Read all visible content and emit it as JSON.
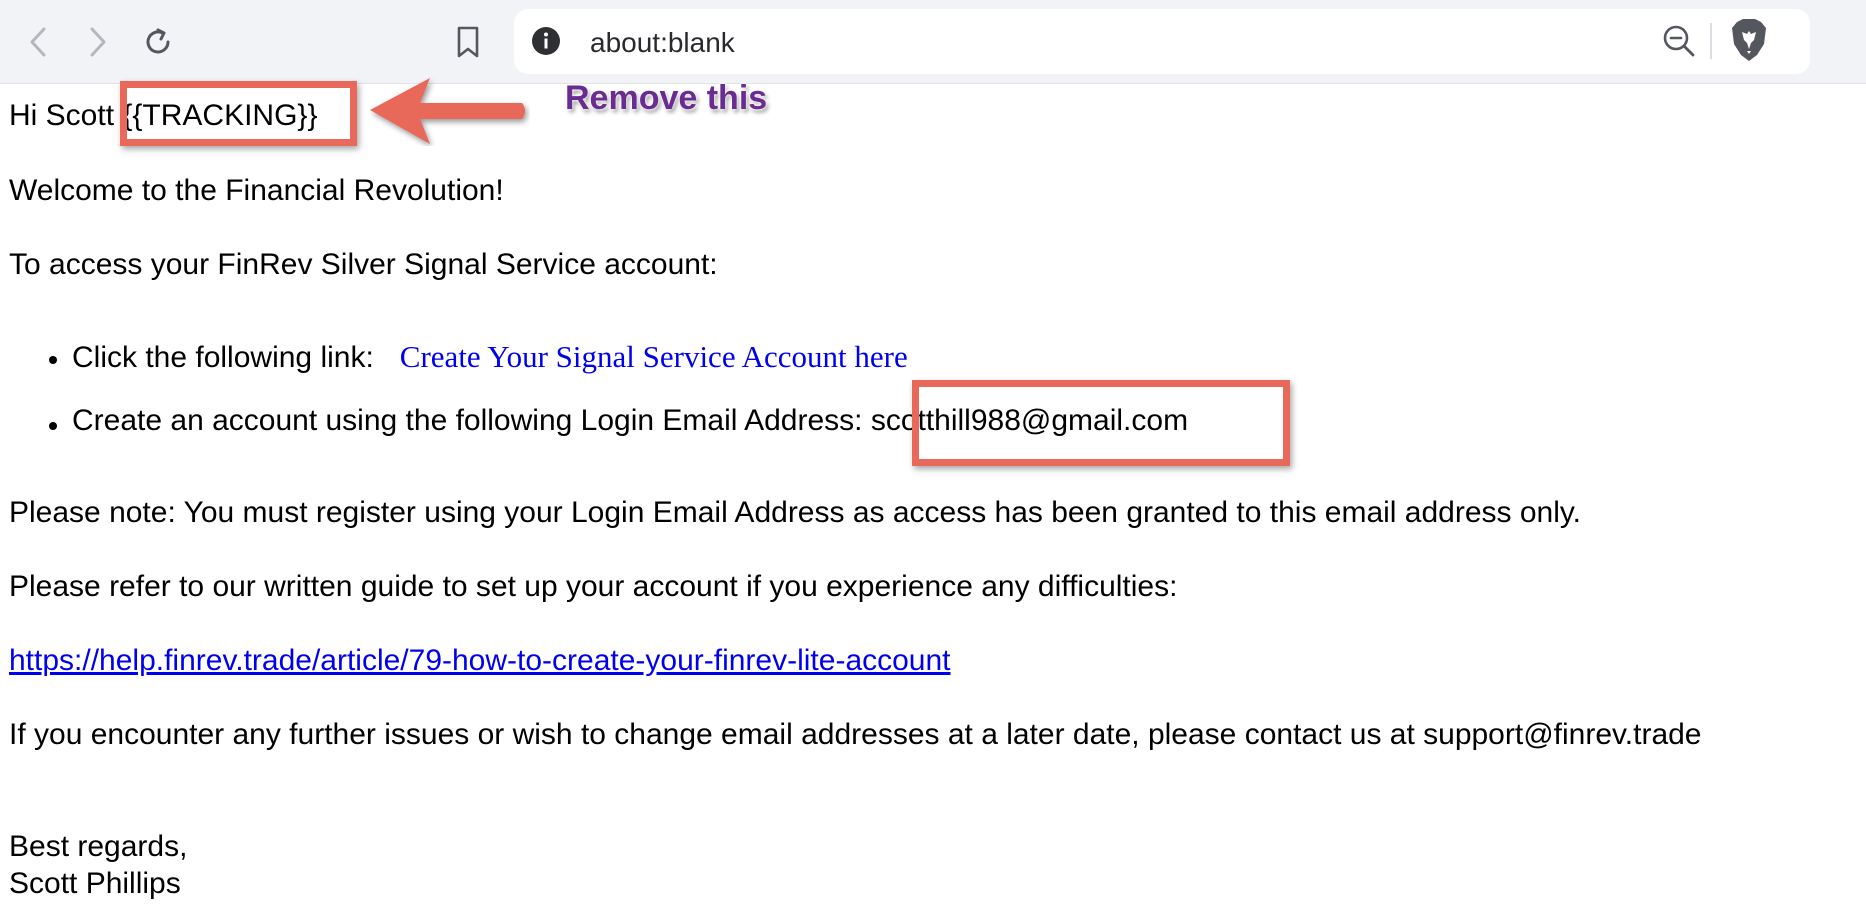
{
  "browser": {
    "back_icon": "chevron-left-icon",
    "forward_icon": "chevron-right-icon",
    "reload_icon": "reload-icon",
    "bookmark_icon": "bookmark-icon",
    "address": "about:blank",
    "info_icon": "info-icon",
    "zoom_icon": "zoom-out-icon",
    "shield_icon": "brave-lion-icon"
  },
  "email": {
    "greeting_prefix": "Hi Scott ",
    "tracking_token": "{{TRACKING}}",
    "welcome": "Welcome to the Financial Revolution!",
    "access_intro": "To access your FinRev Silver Signal Service account:",
    "bullets": [
      {
        "text": "Click the following link:",
        "link_text": "Create Your Signal Service Account here"
      },
      {
        "text": "Create an account using the following Login Email Address: ",
        "value": "scotthill988@gmail.com"
      }
    ],
    "note": "Please note: You must register using your Login Email Address as access has been granted to this email address only.",
    "guide_intro": "Please refer to our written guide to set up your account if you experience any difficulties:",
    "guide_link": "https://help.finrev.trade/article/79-how-to-create-your-finrev-lite-account",
    "further": "If you encounter any further issues or wish to change email addresses at a later date, please contact us at support@finrev.trade",
    "signoff": "Best regards,",
    "signature": "Scott Phillips"
  },
  "annotation": {
    "callout_text": "Remove this",
    "box_color": "#e8695a",
    "text_color": "#6a2c91"
  }
}
